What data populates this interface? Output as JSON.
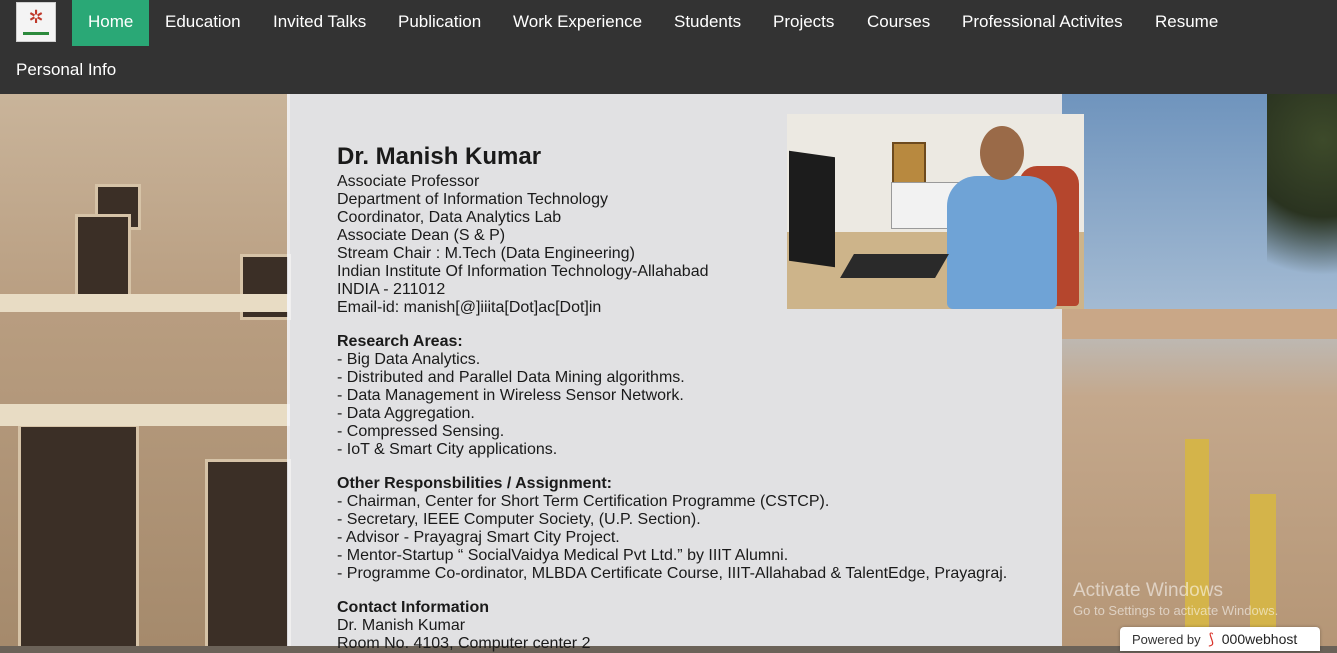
{
  "nav": {
    "items": [
      {
        "label": "Home",
        "active": true
      },
      {
        "label": "Education"
      },
      {
        "label": "Invited Talks"
      },
      {
        "label": "Publication"
      },
      {
        "label": "Work Experience"
      },
      {
        "label": "Students"
      },
      {
        "label": "Projects"
      },
      {
        "label": "Courses"
      },
      {
        "label": "Professional Activites"
      },
      {
        "label": "Resume"
      },
      {
        "label": "Personal Info"
      }
    ],
    "active_color": "#2aa876",
    "bar_color": "#333333"
  },
  "profile": {
    "name": "Dr. Manish Kumar",
    "lines": [
      "Associate Professor",
      "Department of Information Technology",
      "Coordinator, Data Analytics Lab",
      "Associate Dean (S & P)",
      "Stream Chair : M.Tech (Data Engineering)",
      "Indian Institute Of Information Technology-Allahabad",
      "INDIA - 211012",
      "Email-id: manish[@]iiita[Dot]ac[Dot]in"
    ]
  },
  "research": {
    "title": "Research Areas:",
    "items": [
      "- Big Data Analytics.",
      "- Distributed and Parallel Data Mining algorithms.",
      "- Data Management in Wireless Sensor Network.",
      "- Data Aggregation.",
      "- Compressed Sensing.",
      "- IoT & Smart City applications."
    ]
  },
  "responsibilities": {
    "title": "Other Responsbilities / Assignment:",
    "items": [
      "- Chairman, Center for Short Term Certification Programme (CSTCP).",
      "- Secretary, IEEE Computer Society, (U.P. Section).",
      "- Advisor - Prayagraj Smart City Project.",
      "- Mentor-Startup “ SocialVaidya Medical Pvt Ltd.” by IIIT Alumni.",
      "- Programme Co-ordinator, MLBDA Certificate Course, IIIT-Allahabad & TalentEdge, Prayagraj."
    ]
  },
  "contact": {
    "title": "Contact Information",
    "items": [
      "Dr. Manish Kumar",
      "Room No. 4103, Computer center 2"
    ]
  },
  "watermark": {
    "title": "Activate Windows",
    "subtitle": "Go to Settings to activate Windows."
  },
  "powered": {
    "prefix": "Powered by",
    "brand": "000webhost"
  }
}
